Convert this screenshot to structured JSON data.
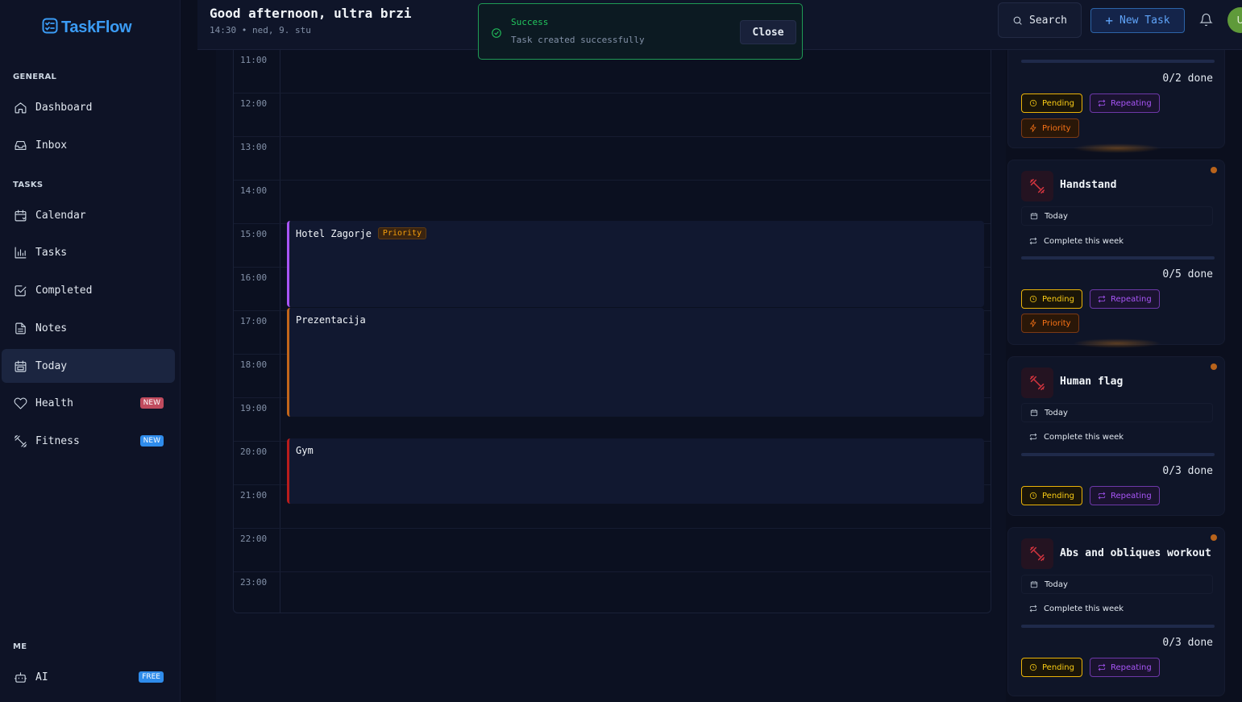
{
  "app": {
    "name": "TaskFlow"
  },
  "header": {
    "greeting": "Good afternoon, ultra brzi",
    "subdate": "14:30 • ned, 9. stu",
    "search_label": "Search",
    "new_task_label": "New Task",
    "avatar_initial": "U"
  },
  "toast": {
    "title": "Success",
    "message": "Task created successfully",
    "close_label": "Close"
  },
  "sidebar": {
    "section_general": "GENERAL",
    "section_tasks": "TASKS",
    "section_me": "ME",
    "items": [
      {
        "label": "Dashboard",
        "icon": "home-icon"
      },
      {
        "label": "Inbox",
        "icon": "inbox-icon"
      },
      {
        "label": "Calendar",
        "icon": "calendar-icon"
      },
      {
        "label": "Tasks",
        "icon": "bar-chart-icon"
      },
      {
        "label": "Completed",
        "icon": "check-square-icon"
      },
      {
        "label": "Notes",
        "icon": "file-text-icon"
      },
      {
        "label": "Today",
        "icon": "calendar-day-icon",
        "active": true
      },
      {
        "label": "Health",
        "icon": "heart-icon",
        "badge": "NEW"
      },
      {
        "label": "Fitness",
        "icon": "dumbbell-icon",
        "badge": "NEW"
      },
      {
        "label": "AI",
        "icon": "robot-icon",
        "badge": "FREE"
      }
    ]
  },
  "calendar": {
    "hours": [
      "11:00",
      "12:00",
      "13:00",
      "14:00",
      "15:00",
      "16:00",
      "17:00",
      "18:00",
      "19:00",
      "20:00",
      "21:00",
      "22:00",
      "23:00"
    ],
    "events": [
      {
        "title": "Hotel Zagorje",
        "badge": "Priority",
        "color": "#a855f7"
      },
      {
        "title": "Prezentacija",
        "color": "#c2661a"
      },
      {
        "title": "Gym",
        "color": "#b91c1c"
      }
    ]
  },
  "tasks": [
    {
      "title": "",
      "today": "",
      "repeat": "",
      "done": "0/2 done",
      "pending": "Pending",
      "repeating": "Repeating",
      "priority": "Priority"
    },
    {
      "title": "Handstand",
      "today": "Today",
      "repeat": "Complete this week",
      "done": "0/5 done",
      "pending": "Pending",
      "repeating": "Repeating",
      "priority": "Priority"
    },
    {
      "title": "Human flag",
      "today": "Today",
      "repeat": "Complete this week",
      "done": "0/3 done",
      "pending": "Pending",
      "repeating": "Repeating"
    },
    {
      "title": "Abs and obliques workout",
      "today": "Today",
      "repeat": "Complete this week",
      "done": "0/3 done",
      "pending": "Pending",
      "repeating": "Repeating"
    }
  ],
  "colors": {
    "accent": "#3b9cf5",
    "success": "#22c55e",
    "pending": "#facc15",
    "repeating": "#a855f7",
    "priority": "#f97316"
  }
}
